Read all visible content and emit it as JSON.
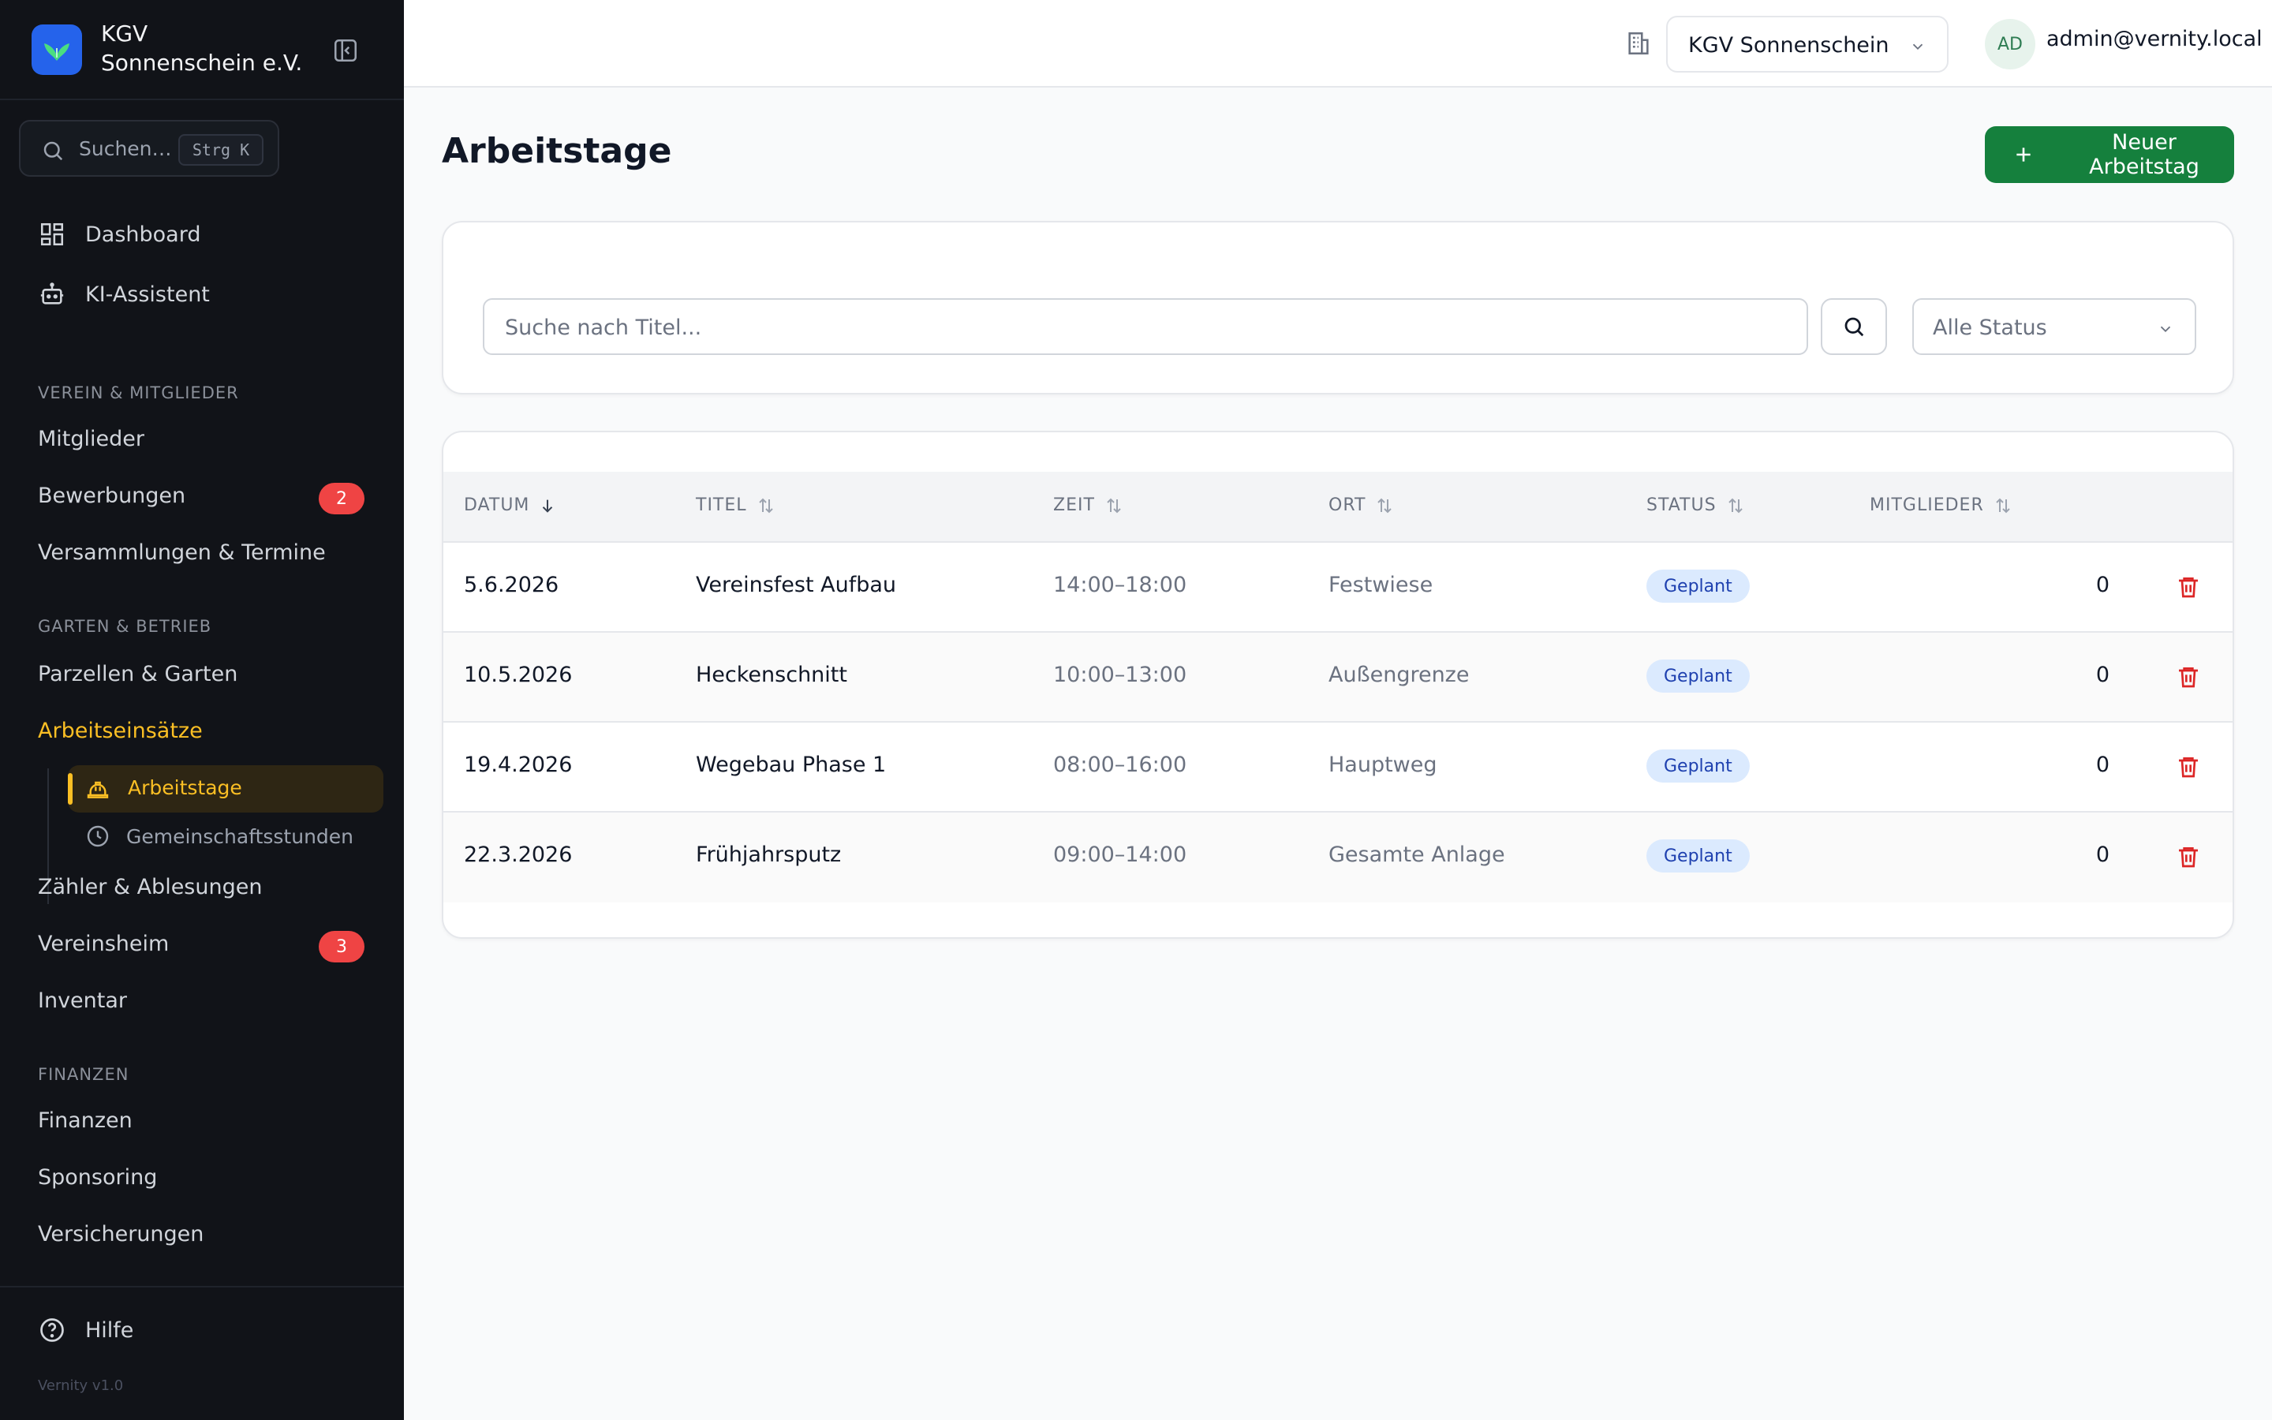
{
  "app": {
    "brand_name": "KGV Sonnenschein e.V.",
    "version": "Vernity v1.0"
  },
  "sidebar": {
    "search_placeholder": "Suchen…",
    "search_shortcut": "Strg K",
    "top_items": [
      {
        "label": "Dashboard",
        "icon": "dashboard-icon"
      },
      {
        "label": "KI-Assistent",
        "icon": "robot-icon"
      }
    ],
    "sections": [
      {
        "title": "VEREIN & MITGLIEDER",
        "items": [
          {
            "label": "Mitglieder"
          },
          {
            "label": "Bewerbungen",
            "badge": "2"
          },
          {
            "label": "Versammlungen & Termine"
          }
        ]
      },
      {
        "title": "GARTEN & BETRIEB",
        "items": [
          {
            "label": "Parzellen & Garten"
          },
          {
            "label": "Arbeitseinsätze",
            "active": true
          },
          {
            "label": "Zähler & Ablesungen"
          },
          {
            "label": "Vereinsheim",
            "badge": "3"
          },
          {
            "label": "Inventar"
          }
        ],
        "sub_items": [
          {
            "label": "Arbeitstage",
            "icon": "hard-hat-icon",
            "active": true
          },
          {
            "label": "Gemeinschaftsstunden",
            "icon": "clock-icon"
          }
        ]
      },
      {
        "title": "FINANZEN",
        "items": [
          {
            "label": "Finanzen"
          },
          {
            "label": "Sponsoring"
          },
          {
            "label": "Versicherungen"
          }
        ]
      }
    ],
    "help_label": "Hilfe"
  },
  "topbar": {
    "org_name": "KGV Sonnenschein e.V.",
    "avatar_initials": "AD",
    "user_email": "admin@vernity.local"
  },
  "page": {
    "title": "Arbeitstage",
    "new_button": "Neuer Arbeitstag"
  },
  "filters": {
    "search_placeholder": "Suche nach Titel...",
    "status_value": "Alle Status"
  },
  "table": {
    "columns": [
      "DATUM",
      "TITEL",
      "ZEIT",
      "ORT",
      "STATUS",
      "MITGLIEDER"
    ],
    "rows": [
      {
        "date": "5.6.2026",
        "title": "Vereinsfest Aufbau",
        "time": "14:00–18:00",
        "place": "Festwiese",
        "status": "Geplant",
        "members": "0"
      },
      {
        "date": "10.5.2026",
        "title": "Heckenschnitt",
        "time": "10:00–13:00",
        "place": "Außengrenze",
        "status": "Geplant",
        "members": "0"
      },
      {
        "date": "19.4.2026",
        "title": "Wegebau Phase 1",
        "time": "08:00–16:00",
        "place": "Hauptweg",
        "status": "Geplant",
        "members": "0"
      },
      {
        "date": "22.3.2026",
        "title": "Frühjahrsputz",
        "time": "09:00–14:00",
        "place": "Gesamte Anlage",
        "status": "Geplant",
        "members": "0"
      }
    ]
  },
  "colors": {
    "sidebar_bg": "#111318",
    "accent_active": "#fbbf24",
    "primary_button": "#15803d",
    "badge": "#ef4444",
    "status_pill_bg": "#dbeafe",
    "delete_icon": "#dc2626"
  }
}
